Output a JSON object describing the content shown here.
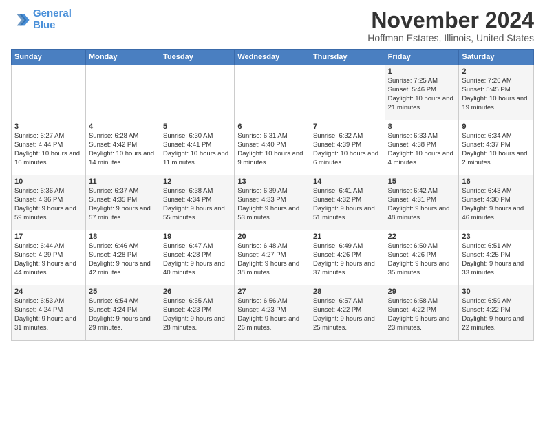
{
  "logo": {
    "line1": "General",
    "line2": "Blue"
  },
  "title": "November 2024",
  "location": "Hoffman Estates, Illinois, United States",
  "headers": [
    "Sunday",
    "Monday",
    "Tuesday",
    "Wednesday",
    "Thursday",
    "Friday",
    "Saturday"
  ],
  "weeks": [
    [
      {
        "day": "",
        "info": ""
      },
      {
        "day": "",
        "info": ""
      },
      {
        "day": "",
        "info": ""
      },
      {
        "day": "",
        "info": ""
      },
      {
        "day": "",
        "info": ""
      },
      {
        "day": "1",
        "info": "Sunrise: 7:25 AM\nSunset: 5:46 PM\nDaylight: 10 hours and 21 minutes."
      },
      {
        "day": "2",
        "info": "Sunrise: 7:26 AM\nSunset: 5:45 PM\nDaylight: 10 hours and 19 minutes."
      }
    ],
    [
      {
        "day": "3",
        "info": "Sunrise: 6:27 AM\nSunset: 4:44 PM\nDaylight: 10 hours and 16 minutes."
      },
      {
        "day": "4",
        "info": "Sunrise: 6:28 AM\nSunset: 4:42 PM\nDaylight: 10 hours and 14 minutes."
      },
      {
        "day": "5",
        "info": "Sunrise: 6:30 AM\nSunset: 4:41 PM\nDaylight: 10 hours and 11 minutes."
      },
      {
        "day": "6",
        "info": "Sunrise: 6:31 AM\nSunset: 4:40 PM\nDaylight: 10 hours and 9 minutes."
      },
      {
        "day": "7",
        "info": "Sunrise: 6:32 AM\nSunset: 4:39 PM\nDaylight: 10 hours and 6 minutes."
      },
      {
        "day": "8",
        "info": "Sunrise: 6:33 AM\nSunset: 4:38 PM\nDaylight: 10 hours and 4 minutes."
      },
      {
        "day": "9",
        "info": "Sunrise: 6:34 AM\nSunset: 4:37 PM\nDaylight: 10 hours and 2 minutes."
      }
    ],
    [
      {
        "day": "10",
        "info": "Sunrise: 6:36 AM\nSunset: 4:36 PM\nDaylight: 9 hours and 59 minutes."
      },
      {
        "day": "11",
        "info": "Sunrise: 6:37 AM\nSunset: 4:35 PM\nDaylight: 9 hours and 57 minutes."
      },
      {
        "day": "12",
        "info": "Sunrise: 6:38 AM\nSunset: 4:34 PM\nDaylight: 9 hours and 55 minutes."
      },
      {
        "day": "13",
        "info": "Sunrise: 6:39 AM\nSunset: 4:33 PM\nDaylight: 9 hours and 53 minutes."
      },
      {
        "day": "14",
        "info": "Sunrise: 6:41 AM\nSunset: 4:32 PM\nDaylight: 9 hours and 51 minutes."
      },
      {
        "day": "15",
        "info": "Sunrise: 6:42 AM\nSunset: 4:31 PM\nDaylight: 9 hours and 48 minutes."
      },
      {
        "day": "16",
        "info": "Sunrise: 6:43 AM\nSunset: 4:30 PM\nDaylight: 9 hours and 46 minutes."
      }
    ],
    [
      {
        "day": "17",
        "info": "Sunrise: 6:44 AM\nSunset: 4:29 PM\nDaylight: 9 hours and 44 minutes."
      },
      {
        "day": "18",
        "info": "Sunrise: 6:46 AM\nSunset: 4:28 PM\nDaylight: 9 hours and 42 minutes."
      },
      {
        "day": "19",
        "info": "Sunrise: 6:47 AM\nSunset: 4:28 PM\nDaylight: 9 hours and 40 minutes."
      },
      {
        "day": "20",
        "info": "Sunrise: 6:48 AM\nSunset: 4:27 PM\nDaylight: 9 hours and 38 minutes."
      },
      {
        "day": "21",
        "info": "Sunrise: 6:49 AM\nSunset: 4:26 PM\nDaylight: 9 hours and 37 minutes."
      },
      {
        "day": "22",
        "info": "Sunrise: 6:50 AM\nSunset: 4:26 PM\nDaylight: 9 hours and 35 minutes."
      },
      {
        "day": "23",
        "info": "Sunrise: 6:51 AM\nSunset: 4:25 PM\nDaylight: 9 hours and 33 minutes."
      }
    ],
    [
      {
        "day": "24",
        "info": "Sunrise: 6:53 AM\nSunset: 4:24 PM\nDaylight: 9 hours and 31 minutes."
      },
      {
        "day": "25",
        "info": "Sunrise: 6:54 AM\nSunset: 4:24 PM\nDaylight: 9 hours and 29 minutes."
      },
      {
        "day": "26",
        "info": "Sunrise: 6:55 AM\nSunset: 4:23 PM\nDaylight: 9 hours and 28 minutes."
      },
      {
        "day": "27",
        "info": "Sunrise: 6:56 AM\nSunset: 4:23 PM\nDaylight: 9 hours and 26 minutes."
      },
      {
        "day": "28",
        "info": "Sunrise: 6:57 AM\nSunset: 4:22 PM\nDaylight: 9 hours and 25 minutes."
      },
      {
        "day": "29",
        "info": "Sunrise: 6:58 AM\nSunset: 4:22 PM\nDaylight: 9 hours and 23 minutes."
      },
      {
        "day": "30",
        "info": "Sunrise: 6:59 AM\nSunset: 4:22 PM\nDaylight: 9 hours and 22 minutes."
      }
    ]
  ]
}
